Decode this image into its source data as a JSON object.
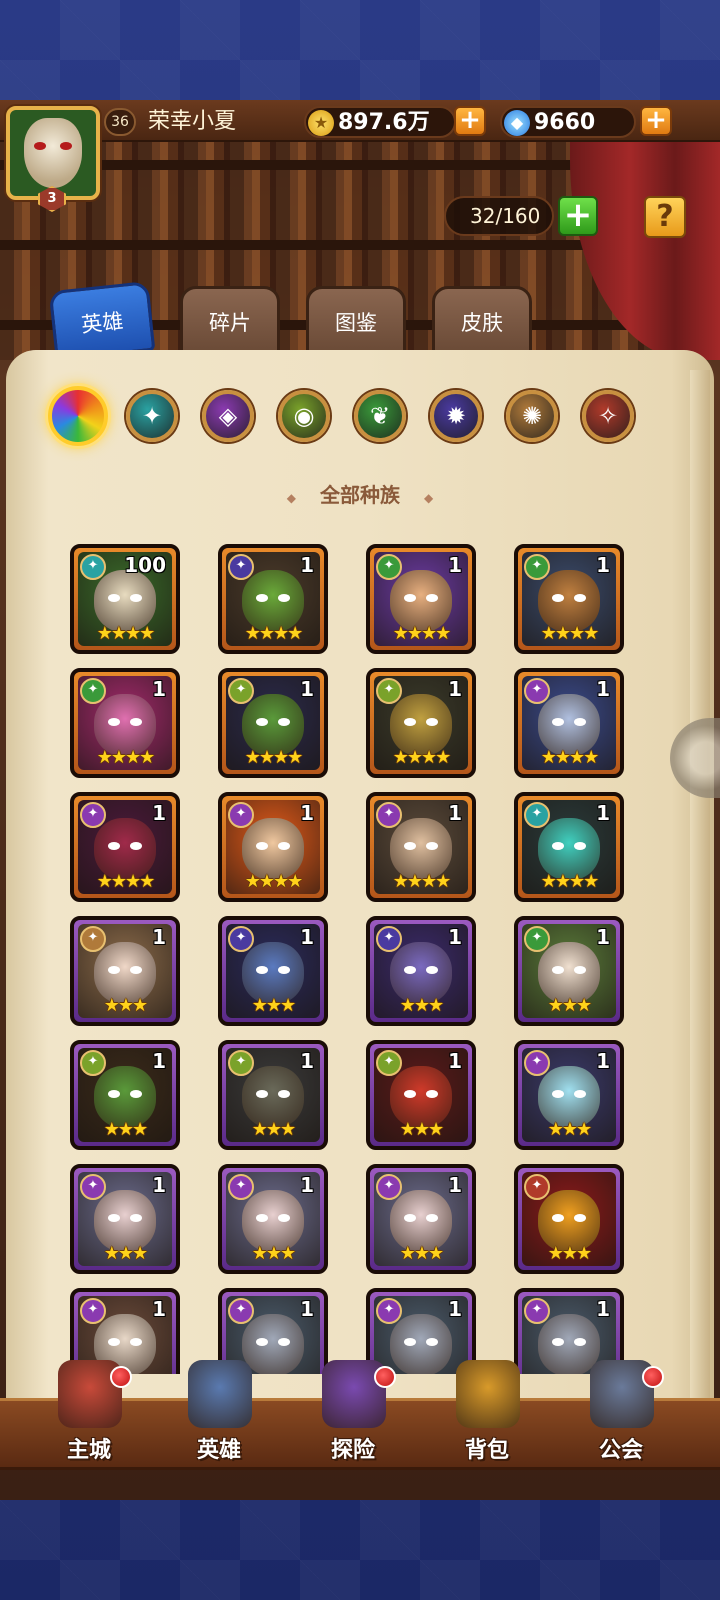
{
  "player": {
    "level": "36",
    "name": "荣幸小夏",
    "rank": "3",
    "gold": "897.6万",
    "gems": "9660"
  },
  "roster": {
    "capacity": "32/160",
    "help": "?"
  },
  "tabs": [
    {
      "label": "英雄",
      "active": true
    },
    {
      "label": "碎片",
      "active": false
    },
    {
      "label": "图鉴",
      "active": false
    },
    {
      "label": "皮肤",
      "active": false
    }
  ],
  "race_filters": [
    {
      "name": "all",
      "color": "#e05a2a",
      "symbol": "",
      "selected": true
    },
    {
      "name": "fortress",
      "color": "#2aa2a2",
      "symbol": "✦"
    },
    {
      "name": "shadow",
      "color": "#8a3ab0",
      "symbol": "◈"
    },
    {
      "name": "orc",
      "color": "#7aa22a",
      "symbol": "◉"
    },
    {
      "name": "forest",
      "color": "#3a9a3a",
      "symbol": "❦"
    },
    {
      "name": "abyss",
      "color": "#4a3aa0",
      "symbol": "✹"
    },
    {
      "name": "light",
      "color": "#b07a3a",
      "symbol": "✺"
    },
    {
      "name": "dark",
      "color": "#b03a2a",
      "symbol": "✧"
    }
  ],
  "race_label": "全部种族",
  "heroes": [
    {
      "count": "100",
      "stars": "★★★★",
      "frame": "orange",
      "race_color": "#2aa2a2",
      "face": "#e8dcc0",
      "bg": "#3a6a2a"
    },
    {
      "count": "1",
      "stars": "★★★★",
      "frame": "orange",
      "race_color": "#4a3aa0",
      "face": "#6aaa3a",
      "bg": "#4a3a2a"
    },
    {
      "count": "1",
      "stars": "★★★★",
      "frame": "orange",
      "race_color": "#3a9a3a",
      "face": "#e8b080",
      "bg": "#6a3aa0"
    },
    {
      "count": "1",
      "stars": "★★★★",
      "frame": "orange",
      "race_color": "#3a9a3a",
      "face": "#c08040",
      "bg": "#3a4a6a"
    },
    {
      "count": "1",
      "stars": "★★★★",
      "frame": "orange",
      "race_color": "#3a9a3a",
      "face": "#e070b0",
      "bg": "#a02a6a"
    },
    {
      "count": "1",
      "stars": "★★★★",
      "frame": "orange",
      "race_color": "#7aa22a",
      "face": "#5a9a3a",
      "bg": "#2a2a4a"
    },
    {
      "count": "1",
      "stars": "★★★★",
      "frame": "orange",
      "race_color": "#7aa22a",
      "face": "#c0a040",
      "bg": "#3a3a2a"
    },
    {
      "count": "1",
      "stars": "★★★★",
      "frame": "orange",
      "race_color": "#8a3ab0",
      "face": "#b0c0e0",
      "bg": "#3a4a8a"
    },
    {
      "count": "1",
      "stars": "★★★★",
      "frame": "orange",
      "race_color": "#8a3ab0",
      "face": "#a02a4a",
      "bg": "#4a1a3a"
    },
    {
      "count": "1",
      "stars": "★★★★",
      "frame": "orange",
      "race_color": "#8a3ab0",
      "face": "#f0c8a0",
      "bg": "#e05a1a"
    },
    {
      "count": "1",
      "stars": "★★★★",
      "frame": "orange",
      "race_color": "#8a3ab0",
      "face": "#e0c0a0",
      "bg": "#5a4a3a"
    },
    {
      "count": "1",
      "stars": "★★★★",
      "frame": "orange",
      "race_color": "#2aa2a2",
      "face": "#40d0c0",
      "bg": "#2a3a3a"
    },
    {
      "count": "1",
      "stars": "★★★",
      "frame": "purple",
      "race_color": "#b07a3a",
      "face": "#f0d8c8",
      "bg": "#8a6a4a"
    },
    {
      "count": "1",
      "stars": "★★★",
      "frame": "purple",
      "race_color": "#4a3aa0",
      "face": "#5a7ac0",
      "bg": "#2a2a5a"
    },
    {
      "count": "1",
      "stars": "★★★",
      "frame": "purple",
      "race_color": "#4a3aa0",
      "face": "#7a6ac0",
      "bg": "#3a2a6a"
    },
    {
      "count": "1",
      "stars": "★★★",
      "frame": "purple",
      "race_color": "#3a9a3a",
      "face": "#f0e0d0",
      "bg": "#5a7a3a"
    },
    {
      "count": "1",
      "stars": "★★★",
      "frame": "purple",
      "race_color": "#7aa22a",
      "face": "#5a9a3a",
      "bg": "#3a2a1a"
    },
    {
      "count": "1",
      "stars": "★★★",
      "frame": "purple",
      "race_color": "#7aa22a",
      "face": "#6a6a5a",
      "bg": "#3a3a3a"
    },
    {
      "count": "1",
      "stars": "★★★",
      "frame": "purple",
      "race_color": "#7aa22a",
      "face": "#d03a2a",
      "bg": "#5a1a1a"
    },
    {
      "count": "1",
      "stars": "★★★",
      "frame": "purple",
      "race_color": "#8a3ab0",
      "face": "#a0e0f0",
      "bg": "#3a3a6a"
    },
    {
      "count": "1",
      "stars": "★★★",
      "frame": "purple",
      "race_color": "#8a3ab0",
      "face": "#e8d0d0",
      "bg": "#6a6a8a"
    },
    {
      "count": "1",
      "stars": "★★★",
      "frame": "purple",
      "race_color": "#8a3ab0",
      "face": "#e8d0d0",
      "bg": "#6a6a8a"
    },
    {
      "count": "1",
      "stars": "★★★",
      "frame": "purple",
      "race_color": "#8a3ab0",
      "face": "#e8d0d0",
      "bg": "#6a6a8a"
    },
    {
      "count": "",
      "stars": "★★★",
      "frame": "purple",
      "race_color": "#b03a2a",
      "face": "#f0a020",
      "bg": "#8a1a1a"
    },
    {
      "count": "1",
      "stars": "",
      "frame": "purple",
      "race_color": "#8a3ab0",
      "face": "#e8d8c8",
      "bg": "#6a4a3a"
    },
    {
      "count": "1",
      "stars": "",
      "frame": "purple",
      "race_color": "#8a3ab0",
      "face": "#a0a8b8",
      "bg": "#4a5a6a"
    },
    {
      "count": "1",
      "stars": "",
      "frame": "purple",
      "race_color": "#8a3ab0",
      "face": "#a0a8b8",
      "bg": "#4a5a6a"
    },
    {
      "count": "1",
      "stars": "",
      "frame": "purple",
      "race_color": "#8a3ab0",
      "face": "#a0a8b8",
      "bg": "#4a5a6a"
    }
  ],
  "nav": [
    {
      "label": "主城",
      "icon": "castle-icon",
      "color": "#c84a3a",
      "badge": true
    },
    {
      "label": "英雄",
      "icon": "hero-icon",
      "color": "#5a7ab0",
      "badge": false
    },
    {
      "label": "探险",
      "icon": "portal-icon",
      "color": "#7a4ab0",
      "badge": true
    },
    {
      "label": "背包",
      "icon": "bag-icon",
      "color": "#d89a2a",
      "badge": false
    },
    {
      "label": "公会",
      "icon": "guild-icon",
      "color": "#6a7a9a",
      "badge": true
    }
  ]
}
